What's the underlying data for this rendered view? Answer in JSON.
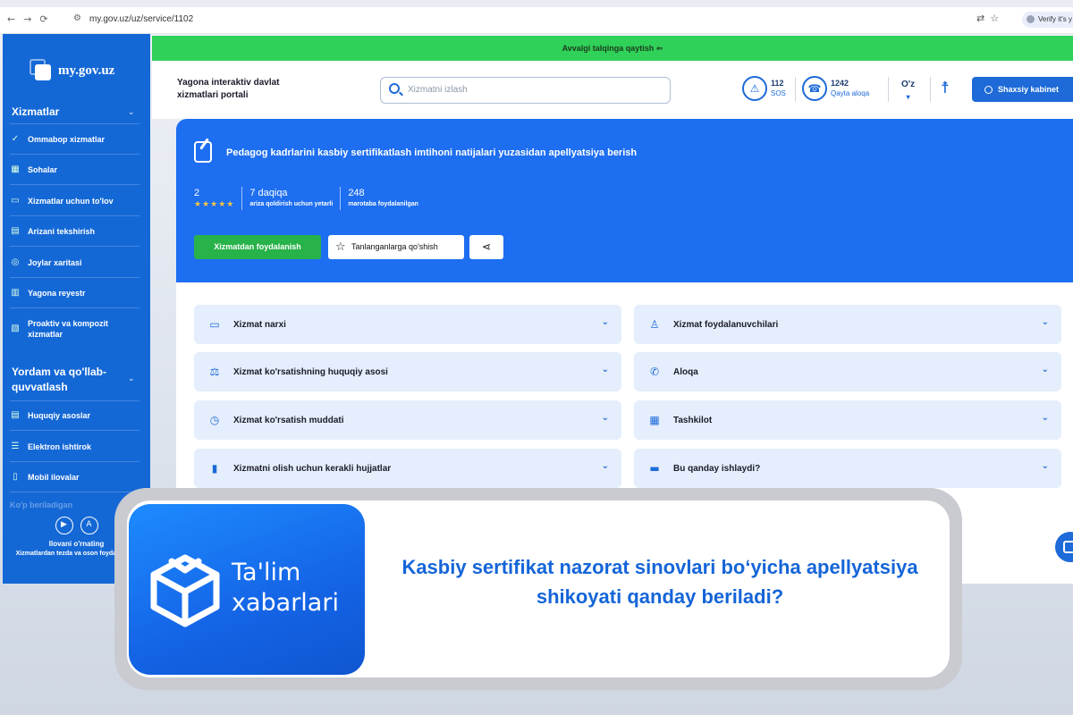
{
  "browser": {
    "url": "my.gov.uz/uz/service/1102",
    "verify_label": "Verify it's y"
  },
  "brand": {
    "name": "my.gov.uz"
  },
  "sidebar": {
    "section1_title": "Xizmatlar",
    "items1": [
      {
        "label": "Ommabop xizmatlar",
        "icon": "check-circle-icon"
      },
      {
        "label": "Sohalar",
        "icon": "grid-icon"
      },
      {
        "label": "Xizmatlar uchun to'lov",
        "icon": "card-icon"
      },
      {
        "label": "Arizani tekshirish",
        "icon": "document-icon"
      },
      {
        "label": "Joylar xaritasi",
        "icon": "map-pin-icon"
      },
      {
        "label": "Yagona reyestr",
        "icon": "register-icon"
      },
      {
        "label": "Proaktiv va kompozit xizmatlar",
        "icon": "proactive-icon"
      }
    ],
    "section2_title": "Yordam va qo'llab-quvvatlash",
    "items2": [
      {
        "label": "Huquqiy asoslar",
        "icon": "law-icon"
      },
      {
        "label": "Elektron ishtirok",
        "icon": "list-icon"
      },
      {
        "label": "Mobil ilovalar",
        "icon": "phone-icon"
      }
    ],
    "faded_item": "Ko'p beriladigan",
    "footer_title": "Ilovani o'rnating",
    "footer_text": "Xizmatlardan tezda va oson foydalanasiz"
  },
  "topbar": {
    "back_label": "Avvalgi talqinga qaytish"
  },
  "header": {
    "portal_title": "Yagona interaktiv davlat xizmatlari portali",
    "search_placeholder": "Xizmatni izlash",
    "sos_number": "112",
    "sos_label": "SOS",
    "callback_number": "1242",
    "callback_label": "Qayta aloqa",
    "lang": "O'z",
    "cabinet_label": "Shaxsiy kabinet"
  },
  "service": {
    "title": "Pedagog kadrlarini kasbiy sertifikatlash imtihoni natijalari yuzasidan apellyatsiya berish",
    "rating_value": "2",
    "rating_stars": 5,
    "duration_value": "7 daqiqa",
    "duration_label": "ariza qoldirish uchun yetarli",
    "usage_value": "248",
    "usage_label": "marotaba foydalanilgan",
    "use_button": "Xizmatdan foydalanish",
    "favorite_button": "Tanlanganlarga qo'shish"
  },
  "accordion": {
    "left": [
      {
        "label": "Xizmat narxi",
        "icon": "wallet-icon"
      },
      {
        "label": "Xizmat ko'rsatishning huquqiy asosi",
        "icon": "scales-icon"
      },
      {
        "label": "Xizmat ko'rsatish muddati",
        "icon": "clock-icon"
      },
      {
        "label": "Xizmatni olish uchun kerakli hujjatlar",
        "icon": "file-icon"
      }
    ],
    "right": [
      {
        "label": "Xizmat foydalanuvchilari",
        "icon": "person-icon"
      },
      {
        "label": "Aloqa",
        "icon": "phone-icon"
      },
      {
        "label": "Tashkilot",
        "icon": "building-icon"
      },
      {
        "label": "Bu qanday ishlaydi?",
        "icon": "chat-icon"
      }
    ]
  },
  "banner": {
    "brand_line1": "Ta'lim",
    "brand_line2": "xabarlari",
    "question": "Kasbiy sertifikat nazorat sinovlari boʻyicha apellyatsiya shikoyati qanday beriladi?"
  },
  "colors": {
    "brand_blue": "#1d6ef0",
    "sidebar_blue": "#1468d6",
    "green": "#30d158",
    "banner_text": "#1565d8"
  }
}
